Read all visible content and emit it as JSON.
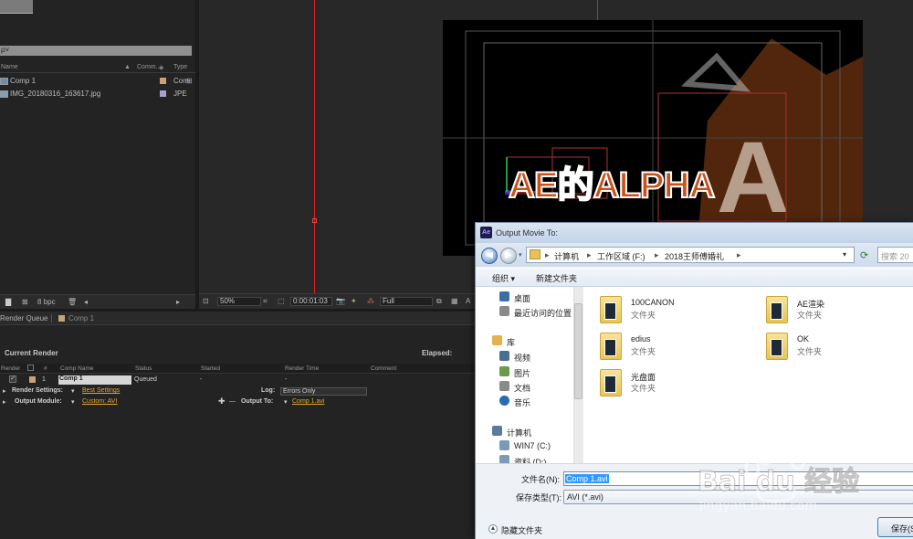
{
  "project": {
    "columns": {
      "name": "Name",
      "comment": "Comm...",
      "type": "Type"
    },
    "items": [
      {
        "name": "Comp 1",
        "type": "Com",
        "swatch": "#c9a27a"
      },
      {
        "name": "IMG_20180316_163617.jpg",
        "type": "JPE",
        "swatch": "#a9a0c8"
      }
    ],
    "footer_bpc": "8 bpc"
  },
  "viewer": {
    "canvas_text": "AE的ALPHA",
    "zoom": "50%",
    "timecode": "0:00:01:03",
    "resolution": "Full"
  },
  "render_queue": {
    "tabs": [
      "Render Queue",
      "Comp 1"
    ],
    "current_render_label": "Current Render",
    "elapsed_label": "Elapsed:",
    "columns": [
      "Render",
      "#",
      "Comp Name",
      "Status",
      "Started",
      "Render Time",
      "Comment"
    ],
    "item": {
      "index": "1",
      "comp_name": "Comp 1",
      "status": "Queued",
      "started": "-",
      "render_time": "-"
    },
    "render_settings_label": "Render Settings:",
    "render_settings_value": "Best Settings",
    "log_label": "Log:",
    "log_value": "Errors Only",
    "output_module_label": "Output Module:",
    "output_module_value": "Custom: AVI",
    "output_to_label": "Output To:",
    "output_to_value": "Comp 1.avi"
  },
  "dialog": {
    "title": "Output Movie To:",
    "breadcrumb": [
      "计算机",
      "工作区域 (F:)",
      "2018王师傅婚礼"
    ],
    "search_placeholder": "搜索 20",
    "toolbar": {
      "organize": "组织 ▾",
      "new_folder": "新建文件夹"
    },
    "nav": [
      {
        "label": "桌面",
        "color": "#3b6ea8"
      },
      {
        "label": "最近访问的位置",
        "color": "#8a8a8a"
      },
      {
        "label": "库",
        "color": "#e3b24a"
      },
      {
        "label": "视频",
        "color": "#4a6d94"
      },
      {
        "label": "图片",
        "color": "#6a9a4a"
      },
      {
        "label": "文档",
        "color": "#8a8a8a"
      },
      {
        "label": "音乐",
        "color": "#2a6ab0"
      },
      {
        "label": "计算机",
        "color": "#5a7aa0"
      },
      {
        "label": "WIN7 (C:)",
        "color": "#7a9ab8"
      },
      {
        "label": "资料 (D:)",
        "color": "#7a9ab8"
      }
    ],
    "files": [
      {
        "name": "100CANON",
        "type": "文件夹"
      },
      {
        "name": "AE渲染",
        "type": "文件夹"
      },
      {
        "name": "edius",
        "type": "文件夹"
      },
      {
        "name": "OK",
        "type": "文件夹"
      },
      {
        "name": "光盘面",
        "type": "文件夹"
      }
    ],
    "filename_label": "文件名(N):",
    "filename_value": "Comp 1.avi",
    "filetype_label": "保存类型(T):",
    "filetype_value": "AVI (*.avi)",
    "hide_folders": "隐藏文件夹",
    "save_button": "保存(S"
  },
  "watermark": {
    "brand": "Bai du 经验",
    "url": "jingyan.baidu.com"
  }
}
